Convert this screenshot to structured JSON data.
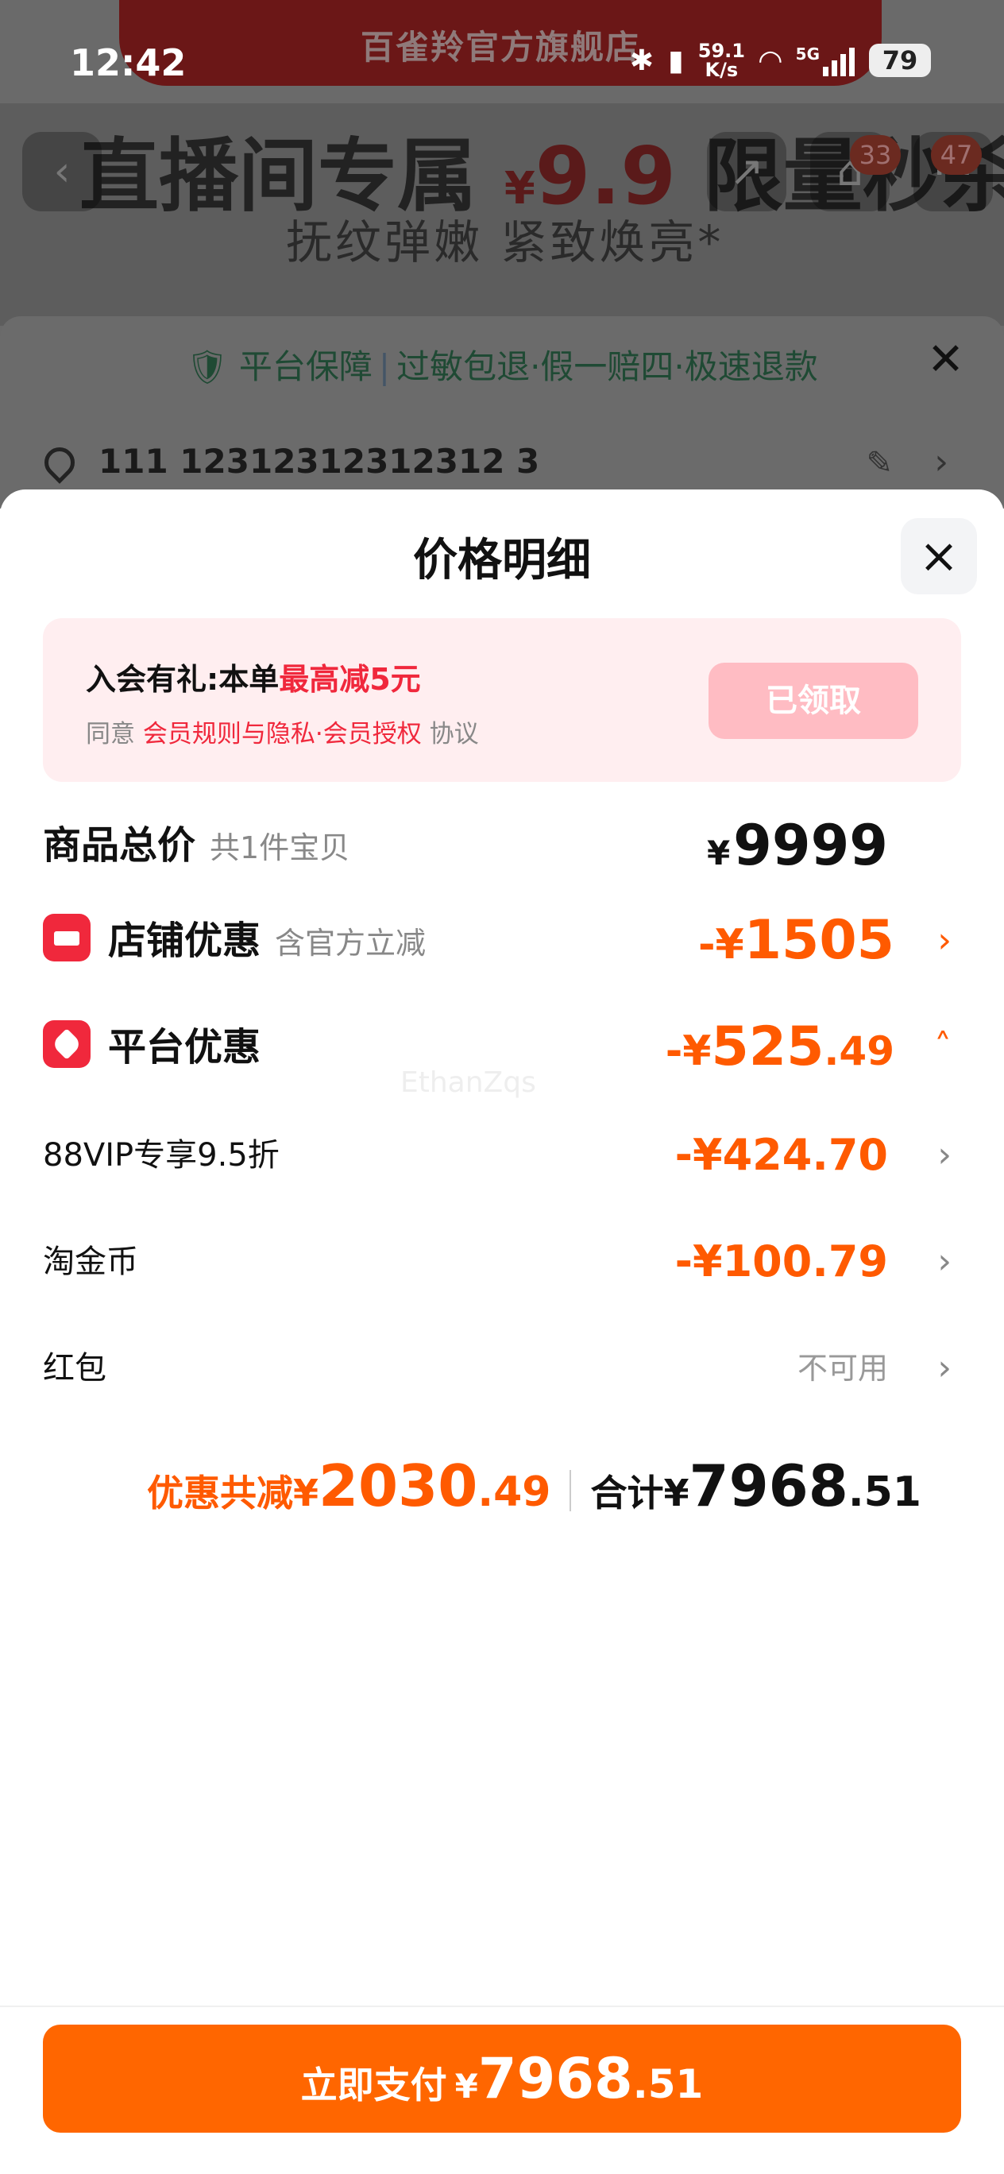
{
  "status_bar": {
    "time": "12:42",
    "net_speed_value": "59.1",
    "net_speed_unit": "K/s",
    "network": "5G",
    "battery": "79"
  },
  "background": {
    "store_name": "百雀羚官方旗舰店",
    "hero_title_pre": "直播间专属",
    "hero_currency": "¥",
    "hero_price": "9.9",
    "hero_title_post": "限量秒杀",
    "hero_subtitle": "抚纹弹嫩 紧致焕亮*",
    "badge_cart": "33",
    "badge_msg": "47",
    "guarantee_title": "平台保障",
    "guarantee_items": "过敏包退·假一赔四·极速退款",
    "address": "111 12312312312312 3"
  },
  "sheet": {
    "title": "价格明细",
    "member": {
      "title_prefix": "入会有礼:本单",
      "title_highlight": "最高减5元",
      "agree_prefix": "同意",
      "agree_links": "会员规则与隐私·会员授权",
      "agree_suffix": "协议",
      "claim_button": "已领取"
    },
    "rows": {
      "goods": {
        "label": "商品总价",
        "sub": "共1件宝贝",
        "currency": "¥",
        "value": "9999"
      },
      "shop": {
        "label": "店铺优惠",
        "sub": "含官方立减",
        "sign": "-",
        "currency": "¥",
        "value": "1505"
      },
      "platform": {
        "label": "平台优惠",
        "sign": "-",
        "currency": "¥",
        "int": "525",
        "dec": ".49"
      },
      "vip": {
        "label": "88VIP专享9.5折",
        "value": "-¥424.70"
      },
      "coin": {
        "label": "淘金币",
        "value": "-¥100.79"
      },
      "redpacket": {
        "label": "红包",
        "value": "不可用"
      }
    },
    "watermark": "EthanZqs",
    "totals": {
      "discount_label": "优惠共减¥",
      "discount_int": "2030",
      "discount_dec": ".49",
      "sum_label": "合计¥",
      "sum_int": "7968",
      "sum_dec": ".51"
    },
    "pay_button": {
      "label": "立即支付",
      "currency": "¥",
      "int": "7968",
      "dec": ".51"
    }
  },
  "colors": {
    "accent_orange": "#ff5a00",
    "pay_button": "#ff6600",
    "member_red": "#f0283c",
    "member_card_bg": "#ffeef0"
  }
}
